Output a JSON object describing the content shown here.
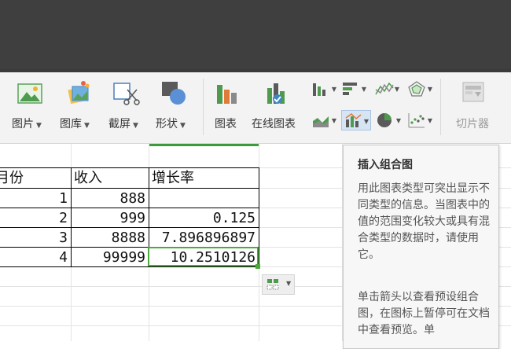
{
  "ribbon": {
    "picture_label": "图片",
    "gallery_label": "图库",
    "screenshot_label": "截屏",
    "shapes_label": "形状",
    "chart_label": "图表",
    "online_chart_label": "在线图表",
    "slicer_label": "切片器"
  },
  "sheet": {
    "headers": [
      "月份",
      "收入",
      "增长率"
    ],
    "rows": [
      {
        "month": "1",
        "income": "888",
        "growth": ""
      },
      {
        "month": "2",
        "income": "999",
        "growth": "0.125"
      },
      {
        "month": "3",
        "income": "8888",
        "growth": "7.896896897"
      },
      {
        "month": "4",
        "income": "99999",
        "growth": "10.2510126"
      }
    ]
  },
  "tooltip": {
    "title": "插入组合图",
    "para1": "用此图表类型可突出显示不同类型的信息。当图表中的值的范围变化较大或具有混合类型的数据时，请使用它。",
    "para2": "单击箭头以查看预设组合图，在图标上暂停可在文档中查看预览。单"
  },
  "colors": {
    "accent_green": "#4caa3c",
    "title_bar": "#3f3f3f",
    "ribbon_bg": "#f3f3f3",
    "tooltip_bg": "#f7f7f7"
  }
}
